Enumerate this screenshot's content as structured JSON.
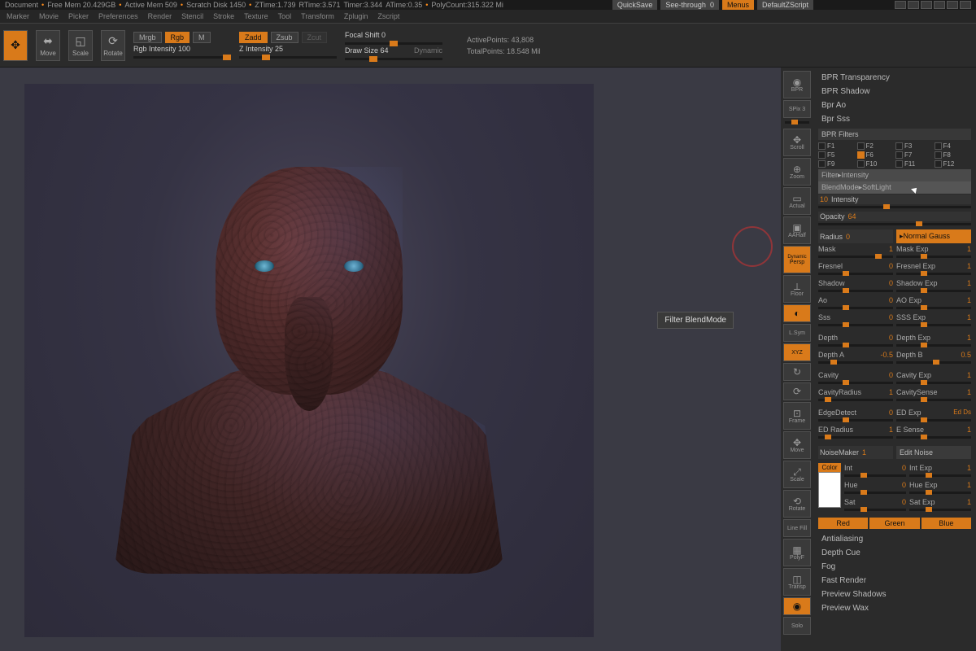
{
  "status": {
    "document": "Document",
    "free_mem": "Free Mem 20.429GB",
    "active_mem": "Active Mem 509",
    "scratch": "Scratch Disk 1450",
    "ztime": "ZTime:1.739",
    "rtime": "RTime:3.571",
    "timer": "Timer:3.344",
    "atime": "ATime:0.35",
    "polycount": "PolyCount:315.322 Mi"
  },
  "top_btns": {
    "quicksave": "QuickSave",
    "seethrough": "See-through",
    "seethrough_val": "0",
    "menus": "Menus",
    "script": "DefaultZScript"
  },
  "menu": [
    "Marker",
    "Movie",
    "Picker",
    "Preferences",
    "Render",
    "Stencil",
    "Stroke",
    "Texture",
    "Tool",
    "Transform",
    "Zplugin",
    "Zscript"
  ],
  "toolbar": {
    "tools": [
      {
        "lbl": "",
        "g": "✥"
      },
      {
        "lbl": "Move",
        "g": "⬌"
      },
      {
        "lbl": "Scale",
        "g": "◱"
      },
      {
        "lbl": "Rotate",
        "g": "⟳"
      }
    ],
    "mrgb": "Mrgb",
    "rgb": "Rgb",
    "m": "M",
    "rgb_int_lbl": "Rgb Intensity",
    "rgb_int_val": "100",
    "zadd": "Zadd",
    "zsub": "Zsub",
    "zcut": "Zcut",
    "z_int_lbl": "Z Intensity",
    "z_int_val": "25",
    "focal_lbl": "Focal Shift",
    "focal_val": "0",
    "draw_lbl": "Draw Size",
    "draw_val": "64",
    "dynamic": "Dynamic",
    "active_pts_lbl": "ActivePoints:",
    "active_pts_val": "43,808",
    "total_pts_lbl": "TotalPoints:",
    "total_pts_val": "18.548 Mil"
  },
  "tooltip": "Filter BlendMode",
  "side": [
    "BPR",
    "SPix 3",
    "Scroll",
    "Zoom",
    "Actual",
    "AAHalf",
    "Persp",
    "Floor",
    "",
    "L.Sym",
    "XYZ",
    "",
    "",
    "Frame",
    "Move",
    "Scale",
    "Rotate",
    "Line Fill",
    "PolyF",
    "Transp",
    "",
    "Solo"
  ],
  "side_dynamic": "Dynamic",
  "panel": {
    "bpr_items": [
      "BPR Transparency",
      "BPR Shadow",
      "Bpr Ao",
      "Bpr Sss"
    ],
    "filters_hdr": "BPR Filters",
    "fchips": [
      "F1",
      "F2",
      "F3",
      "F4",
      "F5",
      "F6",
      "F7",
      "F8",
      "F9",
      "F10",
      "F11",
      "F12"
    ],
    "filter_lbl": "Filter",
    "filter_val": "Intensity",
    "blend_lbl": "BlendMode",
    "blend_val": "SoftLight",
    "intensity_val": "10",
    "intensity_lbl": "Intensity",
    "opacity_lbl": "Opacity",
    "opacity_val": "64",
    "radius_lbl": "Radius",
    "radius_val": "0",
    "normal_gauss": "Normal Gauss",
    "left_params": [
      {
        "l": "Mask",
        "v": "1"
      },
      {
        "l": "Fresnel",
        "v": "0"
      },
      {
        "l": "Shadow",
        "v": "0"
      },
      {
        "l": "Ao",
        "v": "0"
      },
      {
        "l": "Sss",
        "v": "0"
      }
    ],
    "right_params": [
      {
        "l": "Mask Exp",
        "v": "1"
      },
      {
        "l": "Fresnel Exp",
        "v": "1"
      },
      {
        "l": "Shadow Exp",
        "v": "1"
      },
      {
        "l": "AO Exp",
        "v": "1"
      },
      {
        "l": "SSS Exp",
        "v": "1"
      }
    ],
    "depth": [
      {
        "l": "Depth",
        "v": "0"
      },
      {
        "l": "Depth A",
        "v": "-0.5"
      }
    ],
    "depth_r": [
      {
        "l": "Depth Exp",
        "v": "1"
      },
      {
        "l": "Depth B",
        "v": "0.5"
      }
    ],
    "cavity": [
      {
        "l": "Cavity",
        "v": "0"
      },
      {
        "l": "CavityRadius",
        "v": "1"
      }
    ],
    "cavity_r": [
      {
        "l": "Cavity Exp",
        "v": "1"
      },
      {
        "l": "CavitySense",
        "v": "1"
      }
    ],
    "edge": [
      {
        "l": "EdgeDetect",
        "v": "0"
      },
      {
        "l": "ED Radius",
        "v": "1"
      }
    ],
    "edge_r": [
      {
        "l": "ED Exp",
        "v": ""
      },
      {
        "l": "E Sense",
        "v": "1"
      }
    ],
    "edge_ds": "Ed Ds",
    "noise_lbl": "NoiseMaker",
    "noise_val": "1",
    "edit_noise": "Edit Noise",
    "color_hdr": "Color",
    "col_l": [
      {
        "l": "Int",
        "v": "0"
      },
      {
        "l": "Hue",
        "v": "0"
      },
      {
        "l": "Sat",
        "v": "0"
      }
    ],
    "col_r": [
      {
        "l": "Int Exp",
        "v": "1"
      },
      {
        "l": "Hue Exp",
        "v": "1"
      },
      {
        "l": "Sat Exp",
        "v": "1"
      }
    ],
    "rgb": [
      "Red",
      "Green",
      "Blue"
    ],
    "bottom": [
      "Antialiasing",
      "Depth Cue",
      "Fog",
      "Fast Render",
      "Preview Shadows",
      "Preview Wax"
    ]
  }
}
